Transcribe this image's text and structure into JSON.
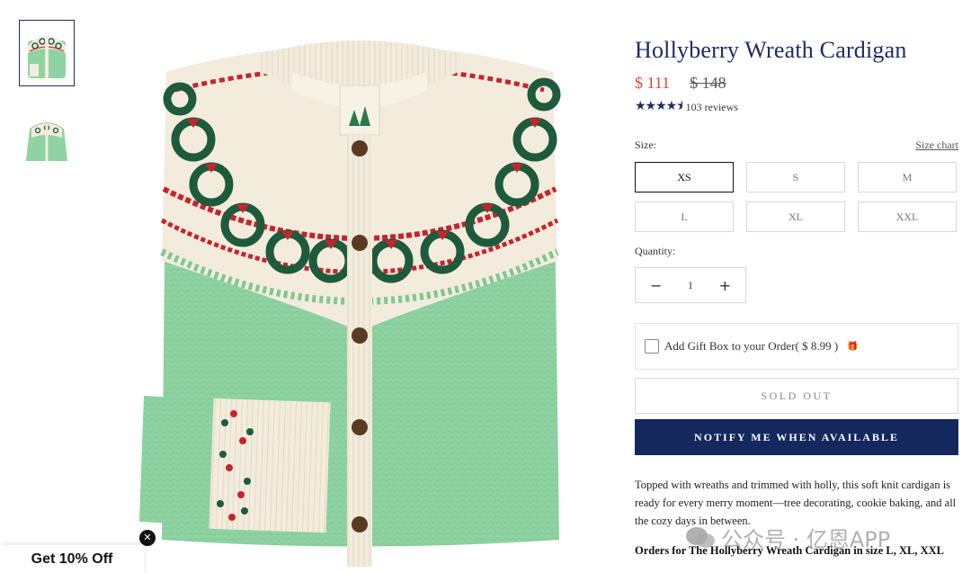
{
  "product": {
    "title": "Hollyberry Wreath Cardigan",
    "price": "$ 111",
    "compare_price": "$ 148",
    "stars": "★★★★⯨",
    "reviews": "103 reviews"
  },
  "size": {
    "label": "Size:",
    "chart_link": "Size chart",
    "options": [
      "XS",
      "S",
      "M",
      "L",
      "XL",
      "XXL"
    ],
    "selected": "XS"
  },
  "quantity": {
    "label": "Quantity:",
    "value": "1",
    "minus": "−",
    "plus": "+"
  },
  "gift": {
    "label": "Add Gift Box to your Order( $ 8.99 )",
    "icon": "gift-icon"
  },
  "buttons": {
    "sold_out": "SOLD OUT",
    "notify": "NOTIFY ME WHEN AVAILABLE"
  },
  "description": "Topped with wreaths and trimmed with holly, this soft knit cardigan is ready for every merry moment—tree decorating, cookie baking, and all the cozy days in between.",
  "orders_note": "Orders for The Hollyberry Wreath Cardigan in size L, XL, XXL",
  "promo": {
    "label": "Get 10% Off",
    "close": "✕"
  },
  "watermark": "公众号 · 亿恩APP",
  "colors": {
    "accent": "#14285e",
    "sale": "#e0473b",
    "sweater_green": "#8fd3a2",
    "knit_red": "#c8232c",
    "knit_green": "#1e5b3c",
    "cream": "#f3ecdd"
  }
}
